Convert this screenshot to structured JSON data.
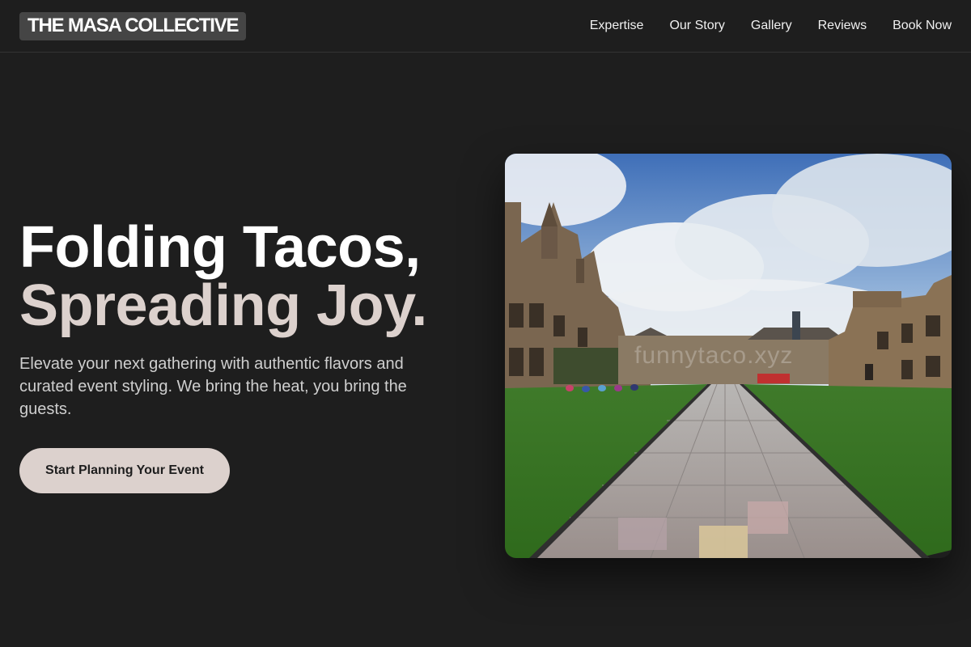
{
  "brand": {
    "name": "THE MASA COLLECTIVE"
  },
  "nav": {
    "links": [
      {
        "label": "Expertise"
      },
      {
        "label": "Our Story"
      },
      {
        "label": "Gallery"
      },
      {
        "label": "Reviews"
      },
      {
        "label": "Book Now"
      }
    ]
  },
  "hero": {
    "headline_line1": "Folding Tacos,",
    "headline_line2": "Spreading Joy.",
    "subtext": "Elevate your next gathering with authentic flavors and curated event styling. We bring the heat, you bring the guests.",
    "cta_label": "Start Planning Your Event",
    "image": {
      "subject": "university quadrangle with sandstone buildings, lawn and paved walkway under cloudy sky",
      "watermark": "funnytaco.xyz"
    }
  },
  "colors": {
    "background": "#1e1e1e",
    "accent": "#dcd1cd",
    "logo_bg": "#454545",
    "text": "#f2f2f2"
  }
}
